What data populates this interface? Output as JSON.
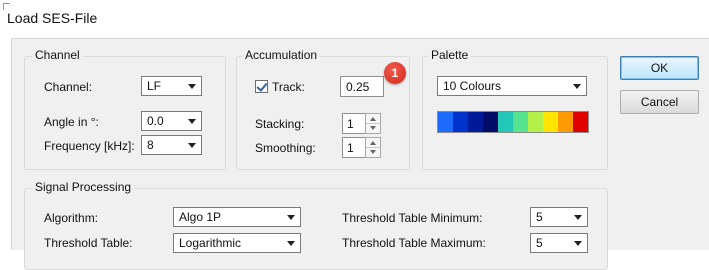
{
  "window": {
    "title": "Load SES-File"
  },
  "channel_group": {
    "label": "Channel",
    "channel_label": "Channel:",
    "channel_value": "LF",
    "angle_label": "Angle in °:",
    "angle_value": "0.0",
    "frequency_label": "Frequency [kHz]:",
    "frequency_value": "8"
  },
  "accumulation_group": {
    "label": "Accumulation",
    "track_label": "Track:",
    "track_checked": true,
    "track_value": "0.25",
    "stacking_label": "Stacking:",
    "stacking_value": "1",
    "smoothing_label": "Smoothing:",
    "smoothing_value": "1"
  },
  "palette_group": {
    "label": "Palette",
    "palette_value": "10 Colours",
    "colors": [
      "#1e6bff",
      "#0033cc",
      "#001a99",
      "#000c66",
      "#22c7b8",
      "#57e28f",
      "#b4f04a",
      "#ffe500",
      "#ff9a00",
      "#e00000"
    ]
  },
  "buttons": {
    "ok": "OK",
    "cancel": "Cancel"
  },
  "annotation": {
    "badge_number": "1",
    "badge_color": "#e0352b"
  },
  "signal_group": {
    "label": "Signal Processing",
    "algorithm_label": "Algorithm:",
    "algorithm_value": "Algo 1P",
    "threshold_table_label": "Threshold Table:",
    "threshold_table_value": "Logarithmic",
    "threshold_min_label": "Threshold Table Minimum:",
    "threshold_min_value": "5",
    "threshold_max_label": "Threshold Table Maximum:",
    "threshold_max_value": "5"
  }
}
